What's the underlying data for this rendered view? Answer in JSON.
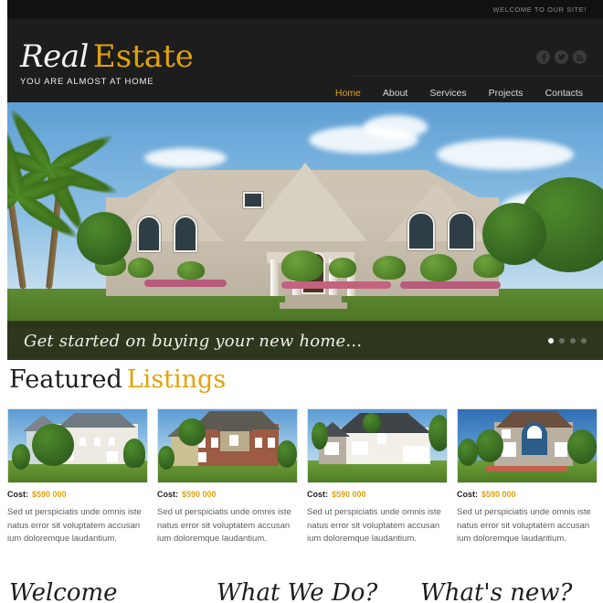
{
  "topbar": {
    "welcome": "WELCOME TO OUR SITE!"
  },
  "header": {
    "logo_primary": "Real",
    "logo_secondary": "Estate",
    "tagline": "YOU ARE ALMOST AT HOME",
    "socials": [
      {
        "name": "facebook-icon",
        "glyph": "f"
      },
      {
        "name": "twitter-icon",
        "glyph": "t"
      },
      {
        "name": "rss-icon",
        "glyph": "◔"
      }
    ],
    "nav": [
      {
        "label": "Home",
        "active": true
      },
      {
        "label": "About",
        "active": false
      },
      {
        "label": "Services",
        "active": false
      },
      {
        "label": "Projects",
        "active": false
      },
      {
        "label": "Contacts",
        "active": false
      }
    ]
  },
  "hero": {
    "caption": "Get started on buying your new home...",
    "slides_total": 4,
    "active_slide": 1
  },
  "featured": {
    "title_dark": "Featured",
    "title_gold": "Listings",
    "cost_label": "Cost:",
    "cards": [
      {
        "cost": "$590 000",
        "text": "Sed ut perspiciatis unde omnis iste natus error sit voluptatem accusan ium doloremque laudantium."
      },
      {
        "cost": "$590 000",
        "text": "Sed ut perspiciatis unde omnis iste natus error sit voluptatem accusan ium doloremque laudantium."
      },
      {
        "cost": "$590 000",
        "text": "Sed ut perspiciatis unde omnis iste natus error sit voluptatem accusan ium doloremque laudantium."
      },
      {
        "cost": "$590 000",
        "text": "Sed ut perspiciatis unde omnis iste natus error sit voluptatem accusan ium doloremque laudantium."
      }
    ]
  },
  "bottom_sections": [
    {
      "heading": "Welcome"
    },
    {
      "heading": "What We Do?"
    },
    {
      "heading": "What's new?"
    }
  ],
  "colors": {
    "accent_gold": "#e2a208",
    "header_dark": "#1d1d1e",
    "topbar_dark": "#111112",
    "body_text": "#5c5c5c"
  }
}
